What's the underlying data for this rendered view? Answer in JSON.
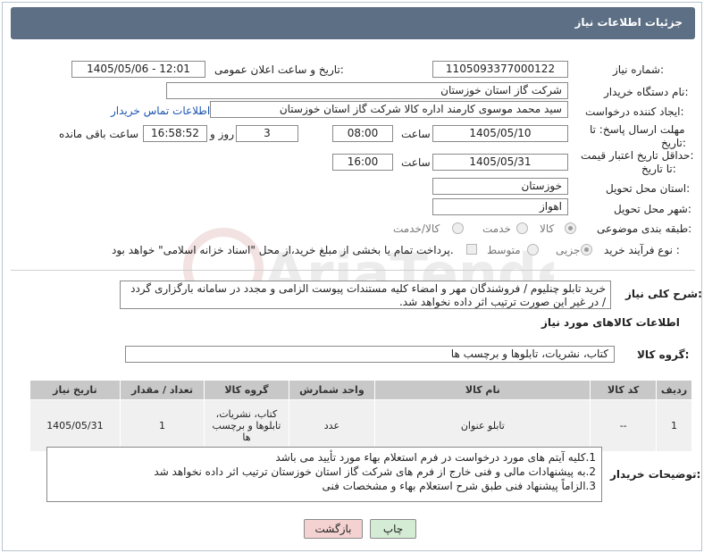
{
  "page_title": "جزئیات اطلاعات نیاز",
  "fields": {
    "need_number_label": "شماره نیاز:",
    "need_number": "1105093377000122",
    "announce_label": "تاریخ و ساعت اعلان عمومی:",
    "announce_value": "1405/05/06 - 12:01",
    "buyer_org_label": "نام دستگاه خریدار:",
    "buyer_org": "شرکت گاز استان خوزستان",
    "creator_label": "ایجاد کننده درخواست:",
    "creator": "سید محمد موسوی کارمند اداره کالا شرکت گاز استان خوزستان",
    "contact_link": "اطلاعات تماس خریدار",
    "deadline_label_1": "مهلت ارسال پاسخ: تا",
    "deadline_label_2": "تاریخ:",
    "deadline_date": "1405/05/10",
    "time_word": "ساعت",
    "deadline_time": "08:00",
    "days_value": "3",
    "days_word": "روز و",
    "remaining_time": "16:58:52",
    "remaining_word": "ساعت باقی مانده",
    "validity_label_1": "حداقل تاریخ اعتبار قیمت:",
    "validity_label_2": "تا تاریخ:",
    "validity_date": "1405/05/31",
    "validity_time": "16:00",
    "province_label": "استان محل تحویل:",
    "province": "خوزستان",
    "city_label": "شهر محل تحویل:",
    "city": "اهواز",
    "category_label": "طبقه بندی موضوعی:",
    "category_options": [
      "کالا",
      "خدمت",
      "کالا/خدمت"
    ],
    "category_selected": "کالا",
    "process_label": "نوع فرآیند خرید :",
    "process_options": [
      "جزیی",
      "متوسط"
    ],
    "process_selected": "جزیی",
    "payment_note": "پرداخت تمام یا بخشی از مبلغ خرید،از محل \"اسناد خزانه اسلامی\" خواهد بود."
  },
  "general_desc_label": "شرح کلی نیاز:",
  "general_desc": "خرید تابلو چنلیوم / فروشندگان مهر و امضاء کلیه مستندات پیوست الزامی و مجدد در سامانه بارگزاری گردد / در غیر این صورت ترتیب اثر داده نخواهد شد.",
  "goods_info_title": "اطلاعات کالاهای مورد نیاز",
  "goods_group_label": "گروه کالا:",
  "goods_group": "کتاب، نشریات، تابلوها و برچسب ها",
  "table": {
    "headers": [
      "ردیف",
      "کد کالا",
      "نام کالا",
      "واحد شمارش",
      "گروه کالا",
      "تعداد / مقدار",
      "تاریخ نیاز"
    ],
    "rows": [
      [
        "1",
        "--",
        "تابلو عنوان",
        "عدد",
        "کتاب، نشریات، تابلوها و برچسب ها",
        "1",
        "1405/05/31"
      ]
    ]
  },
  "buyer_notes_label": "توضیحات خریدار:",
  "buyer_notes": [
    "1.کلیه آیتم های مورد درخواست در فرم استعلام بهاء مورد تأیید می باشد",
    "2.به پیشنهادات مالی و فنی خارج از فرم های شرکت گاز استان خوزستان ترتیب اثر داده نخواهد شد",
    "3.الزاماً پیشنهاد فنی طبق شرح استعلام بهاء و مشخصات فنی"
  ],
  "buttons": {
    "print": "چاپ",
    "back": "بازگشت"
  },
  "colors": {
    "header_bg": "#5d6f84",
    "back_button": "#f5d2d2",
    "print_button": "#d4ecd4",
    "link": "#1a55b0"
  }
}
